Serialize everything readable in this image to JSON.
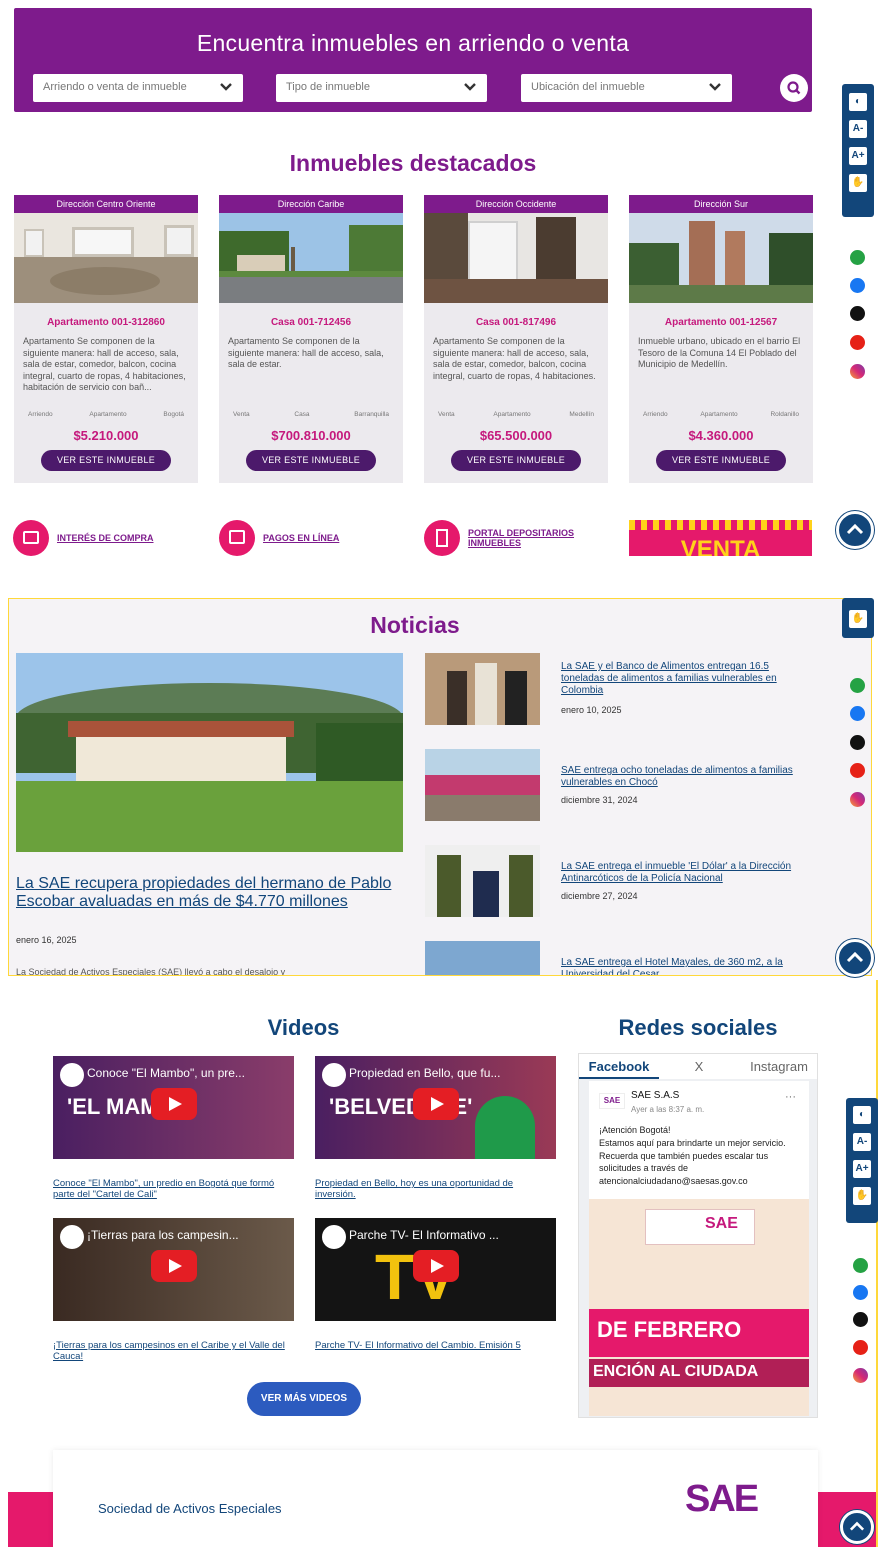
{
  "search": {
    "title": "Encuentra inmuebles en arriendo o venta",
    "select_operation": "Arriendo o venta de inmueble",
    "select_type": "Tipo de inmueble",
    "select_location": "Ubicación del inmueble"
  },
  "featured": {
    "title": "Inmuebles destacados",
    "cards": [
      {
        "direction": "Dirección Centro Oriente",
        "title": "Apartamento 001-312860",
        "desc": "Apartamento Se componen de la siguiente manera: hall de acceso, sala, sala de estar, comedor, balcon, cocina integral, cuarto de ropas, 4 habitaciones, habitación de servicio con bañ...",
        "tag1": "Arriendo",
        "tag2": "Apartamento",
        "tag3": "Bogotá",
        "price": "$5.210.000",
        "button": "VER ESTE INMUEBLE"
      },
      {
        "direction": "Dirección Caribe",
        "title": "Casa 001-712456",
        "desc": "Apartamento Se componen de la siguiente manera: hall de acceso, sala, sala de estar.",
        "tag1": "Venta",
        "tag2": "Casa",
        "tag3": "Barranquilla",
        "price": "$700.810.000",
        "button": "VER ESTE INMUEBLE"
      },
      {
        "direction": "Dirección Occidente",
        "title": "Casa 001-817496",
        "desc": "Apartamento Se componen de la siguiente manera: hall de acceso, sala, sala de estar, comedor, balcon, cocina integral, cuarto de ropas, 4 habitaciones.",
        "tag1": "Venta",
        "tag2": "Apartamento",
        "tag3": "Medellín",
        "price": "$65.500.000",
        "button": "VER ESTE INMUEBLE"
      },
      {
        "direction": "Dirección Sur",
        "title": "Apartamento 001-12567",
        "desc": "Inmueble urbano, ubicado en el barrio El Tesoro de la Comuna 14 El Poblado del Municipio de Medellín.",
        "tag1": "Arriendo",
        "tag2": "Apartamento",
        "tag3": "Roldanillo",
        "price": "$4.360.000",
        "button": "VER ESTE INMUEBLE"
      }
    ]
  },
  "quicklinks": {
    "interes": "INTERÉS DE COMPRA",
    "pagos": "PAGOS EN LÍNEA",
    "portal": "PORTAL DEPOSITARIOS INMUEBLES",
    "banner": "VENTA"
  },
  "news": {
    "title": "Noticias",
    "main_title": "La SAE recupera propiedades del hermano de Pablo Escobar avaluadas en más de $4.770 millones",
    "main_date": "enero 16, 2025",
    "main_excerpt": "La Sociedad de Activos Especiales (SAE) llevó a cabo el desalojo y",
    "items": [
      {
        "title": "La SAE y el Banco de Alimentos entregan 16.5 toneladas de alimentos a familias vulnerables en Colombia",
        "date": "enero 10, 2025"
      },
      {
        "title": "SAE entrega ocho toneladas de alimentos a familias vulnerables en Chocó",
        "date": "diciembre 31, 2024"
      },
      {
        "title": "La SAE entrega el inmueble 'El Dólar' a la Dirección Antinarcóticos de la Policía Nacional",
        "date": "diciembre 27, 2024"
      },
      {
        "title": "La SAE entrega el Hotel Mayales, de 360 m2, a la Universidad del Cesar",
        "date": ""
      }
    ]
  },
  "videos": {
    "title": "Videos",
    "more_button": "VER MÁS VIDEOS",
    "items": [
      {
        "thumb_title": "Conoce \"El Mambo\", un pre...",
        "overlay": "'EL MAMBO'",
        "caption": "Conoce \"El Mambo\", un predio en Bogotá que formó parte del \"Cartel de Cali\""
      },
      {
        "thumb_title": "Propiedad en Bello, que fu...",
        "overlay": "'BELVEDERE'",
        "caption": "Propiedad en Bello, hoy es una oportunidad de inversión."
      },
      {
        "thumb_title": "¡Tierras para los campesin...",
        "overlay": "",
        "caption": "¡Tierras para los campesinos en el Caribe y el Valle del Cauca!"
      },
      {
        "thumb_title": "Parche TV- El Informativo ...",
        "overlay": "TV",
        "caption": "Parche TV- El Informativo del Cambio. Emisión 5"
      }
    ]
  },
  "social": {
    "title": "Redes sociales",
    "tabs": [
      "Facebook",
      "X",
      "Instagram"
    ],
    "post_author": "SAE S.A.S",
    "post_time": "Ayer a las 8:37 a. m.",
    "post_line1": "¡Atención Bogotá!",
    "post_text": "Estamos aquí para brindarte un mejor servicio. Recuerda que también puedes escalar tus solicitudes a través de atencionalciudadano@saesas.gov.co",
    "post_banner1": "DE FEBRERO",
    "post_banner2": "ENCIÓN AL CIUDADA",
    "post_brand": "SAE"
  },
  "footer": {
    "org_name": "Sociedad de Activos Especiales",
    "logo": "SAE"
  },
  "a11y": {
    "contrast": "◐",
    "font_down": "A-",
    "font_up": "A+",
    "sign": "✋"
  },
  "colors": {
    "primary": "#7e1b8c",
    "accent": "#c5197d",
    "pink": "#e5196b",
    "navy": "#12467a"
  }
}
